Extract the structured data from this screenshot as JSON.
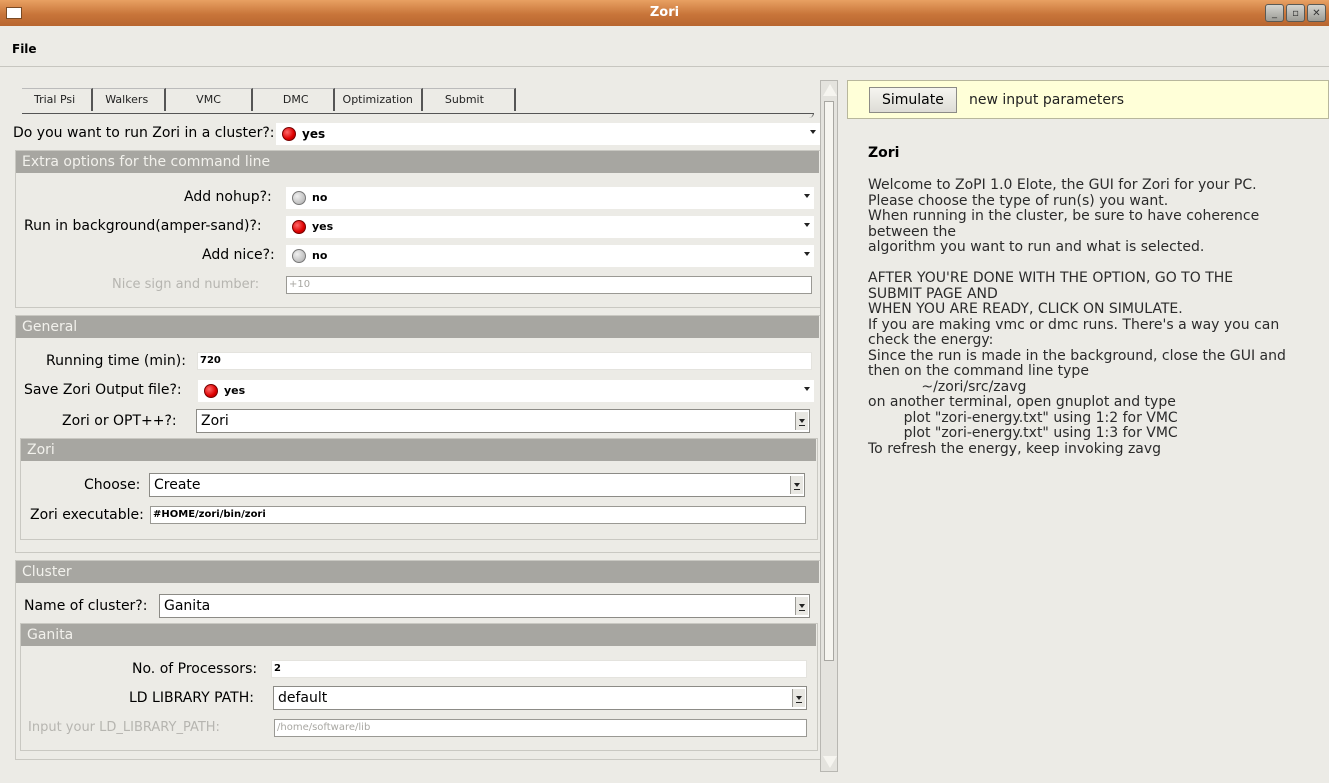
{
  "window": {
    "title": "Zori",
    "buttons": [
      "minimize",
      "maximize",
      "close"
    ]
  },
  "menu": {
    "file_label": "File"
  },
  "tabs": [
    "Trial Psi",
    "Walkers",
    "VMC",
    "DMC",
    "Optimization",
    "Submit"
  ],
  "cluster_question": {
    "label": "Do you want to run Zori in a cluster?:",
    "value": "yes"
  },
  "extra": {
    "header": "Extra options for the command line",
    "nohup": {
      "label": "Add nohup?:",
      "value": "no"
    },
    "background": {
      "label": "Run in background(amper-sand)?:",
      "value": "yes"
    },
    "nice": {
      "label": "Add nice?:",
      "value": "no"
    },
    "nice_sign": {
      "label": "Nice sign and number:",
      "value": "+10"
    }
  },
  "general": {
    "header": "General",
    "running_time": {
      "label": "Running time (min):",
      "value": "720"
    },
    "save_output": {
      "label": "Save Zori Output file?:",
      "value": "yes"
    },
    "zori_or_opt": {
      "label": "Zori or OPT++?:",
      "value": "Zori"
    },
    "zori": {
      "header": "Zori",
      "choose": {
        "label": "Choose:",
        "value": "Create"
      },
      "executable": {
        "label": "Zori executable:",
        "value": "#HOME/zori/bin/zori"
      }
    }
  },
  "cluster": {
    "header": "Cluster",
    "name": {
      "label": "Name of cluster?:",
      "value": "Ganita"
    },
    "ganita": {
      "header": "Ganita",
      "processors": {
        "label": "No. of Processors:",
        "value": "2"
      },
      "ld_path": {
        "label": "LD LIBRARY PATH:",
        "value": "default"
      },
      "ld_input": {
        "label": "Input your LD_LIBRARY_PATH:",
        "value": "/home/software/lib"
      }
    }
  },
  "right": {
    "simulate_label": "Simulate",
    "simulate_message": "new input parameters",
    "title": "Zori",
    "welcome_lines": [
      "Welcome to ZoPI 1.0 Elote, the GUI for Zori for your PC.",
      "Please choose the type of run(s) you want.",
      "When running in the cluster, be sure to have coherence",
      "between the",
      "algorithm you want to run and what is selected.",
      "",
      "AFTER YOU'RE DONE WITH THE OPTION, GO TO THE",
      "SUBMIT PAGE AND",
      "WHEN YOU ARE READY, CLICK ON SIMULATE.",
      "If you are making vmc or dmc runs. There's a way you can",
      "check the energy:",
      "Since the run is made in the background, close the GUI and",
      "then on the command line type",
      "            ~/zori/src/zavg",
      "on another terminal, open gnuplot and type",
      "        plot \"zori-energy.txt\" using 1:2 for VMC",
      "        plot \"zori-energy.txt\" using 1:3 for VMC",
      "To refresh the energy, keep invoking zavg"
    ]
  },
  "colors": {
    "titlebar": "#d4874a",
    "section_header": "#a7a6a1",
    "radio_on": "#dd0000",
    "simulate_bar": "#ffffd8"
  }
}
